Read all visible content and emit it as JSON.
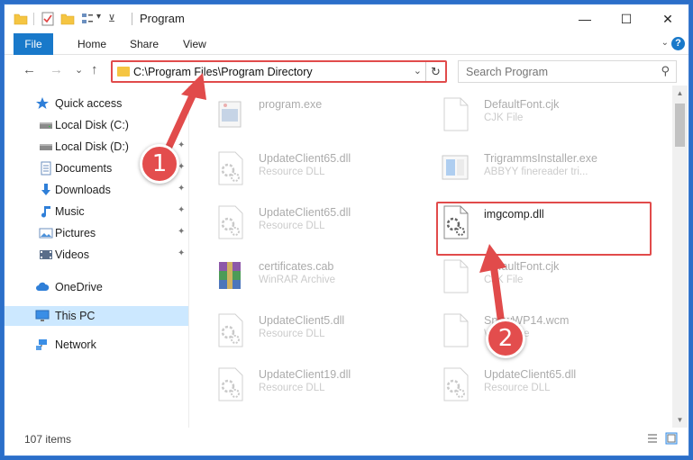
{
  "window": {
    "title": "Program",
    "quick_access_dropdown": "▾",
    "minimize": "—",
    "maximize": "☐",
    "close": "✕"
  },
  "ribbon": {
    "tabs": [
      "File",
      "Home",
      "Share",
      "View"
    ],
    "collapse_chevron": "⌄",
    "help": "?"
  },
  "nav": {
    "back": "←",
    "forward": "→",
    "recent": "⌄",
    "up": "↑",
    "address": "C:\\Program Files\\Program Directory",
    "address_dropdown": "⌄",
    "refresh": "↻",
    "search_placeholder": "Search Program",
    "search_icon": "⚲"
  },
  "navpane": {
    "items": [
      {
        "label": "Quick access",
        "icon": "star-icon",
        "pinned": false
      },
      {
        "label": "Local Disk (C:)",
        "icon": "drive-icon",
        "pinned": true
      },
      {
        "label": "Local Disk (D:)",
        "icon": "drive-icon",
        "pinned": true
      },
      {
        "label": "Documents",
        "icon": "documents-icon",
        "pinned": true
      },
      {
        "label": "Downloads",
        "icon": "download-arrow-icon",
        "pinned": true
      },
      {
        "label": "Music",
        "icon": "music-note-icon",
        "pinned": true
      },
      {
        "label": "Pictures",
        "icon": "pictures-icon",
        "pinned": true
      },
      {
        "label": "Videos",
        "icon": "video-icon",
        "pinned": true
      },
      {
        "label": "OneDrive",
        "icon": "cloud-icon",
        "pinned": false
      },
      {
        "label": "This PC",
        "icon": "monitor-icon",
        "pinned": false,
        "selected": true
      },
      {
        "label": "Network",
        "icon": "network-icon",
        "pinned": false
      }
    ],
    "pin_glyph": "📌"
  },
  "files": [
    {
      "name": "program.exe",
      "type": "",
      "icon": "exe-icon",
      "faded": true
    },
    {
      "name": "DefaultFont.cjk",
      "type": "CJK File",
      "icon": "blank-file-icon",
      "faded": true
    },
    {
      "name": "UpdateClient65.dll",
      "type": "Resource DLL",
      "icon": "dll-gear-icon",
      "faded": true
    },
    {
      "name": "TrigrammsInstaller.exe",
      "type": "ABBYY finereader tri...",
      "icon": "installer-icon",
      "faded": true
    },
    {
      "name": "UpdateClient65.dll",
      "type": "Resource DLL",
      "icon": "dll-gear-icon",
      "faded": true
    },
    {
      "name": "imgcomp.dll",
      "type": "",
      "icon": "dll-gear-icon",
      "faded": false
    },
    {
      "name": "certificates.cab",
      "type": "WinRAR Archive",
      "icon": "winrar-icon",
      "faded": true
    },
    {
      "name": "DefaultFont.cjk",
      "type": "CJK File",
      "icon": "blank-file-icon",
      "faded": true
    },
    {
      "name": "UpdateClient5.dll",
      "type": "Resource DLL",
      "icon": "dll-gear-icon",
      "faded": true
    },
    {
      "name": "SnowWP14.wcm",
      "type": "WCM File",
      "icon": "blank-file-icon",
      "faded": true
    },
    {
      "name": "UpdateClient19.dll",
      "type": "Resource DLL",
      "icon": "dll-gear-icon",
      "faded": true
    },
    {
      "name": "UpdateClient65.dll",
      "type": "Resource DLL",
      "icon": "dll-gear-icon",
      "faded": true
    }
  ],
  "status": {
    "item_count": "107 items"
  },
  "annotations": {
    "step1": "1",
    "step2": "2"
  },
  "colors": {
    "highlight": "#e14b4b",
    "accent": "#1979ca",
    "selection": "#cce8ff"
  }
}
